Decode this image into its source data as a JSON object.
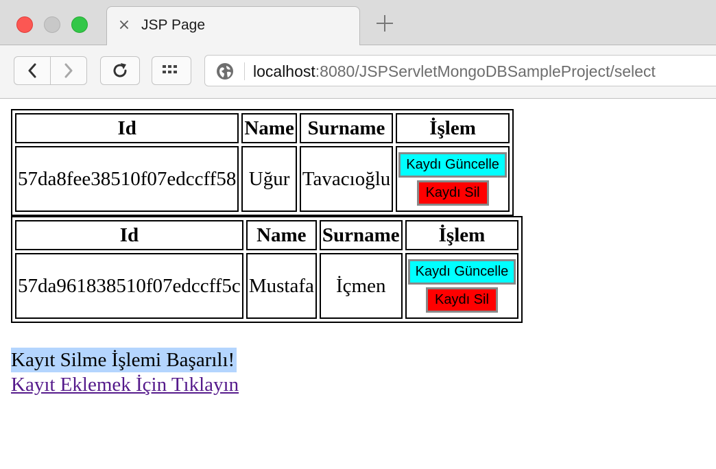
{
  "browser": {
    "tab_title": "JSP Page",
    "url_host": "localhost",
    "url_rest": ":8080/JSPServletMongoDBSampleProject/select",
    "colors": {
      "close": "#fc5753",
      "minimize": "#c8c8c8",
      "zoom": "#33c748"
    }
  },
  "page": {
    "headers": [
      "Id",
      "Name",
      "Surname",
      "İşlem"
    ],
    "records": [
      {
        "id": "57da8fee38510f07edccff58",
        "name": "Uğur",
        "surname": "Tavacıoğlu",
        "update_label": "Kaydı Güncelle",
        "delete_label": "Kaydı Sil"
      },
      {
        "id": "57da961838510f07edccff5c",
        "name": "Mustafa",
        "surname": "İçmen",
        "update_label": "Kaydı Güncelle",
        "delete_label": "Kaydı Sil"
      }
    ],
    "message": "Kayıt Silme İşlemi Başarılı!",
    "add_link": "Kayıt Eklemek İçin Tıklayın",
    "colors": {
      "update_button": "#00ffff",
      "delete_button": "#ff0000",
      "link": "#551a8b",
      "selection": "#b4d5fe"
    }
  }
}
